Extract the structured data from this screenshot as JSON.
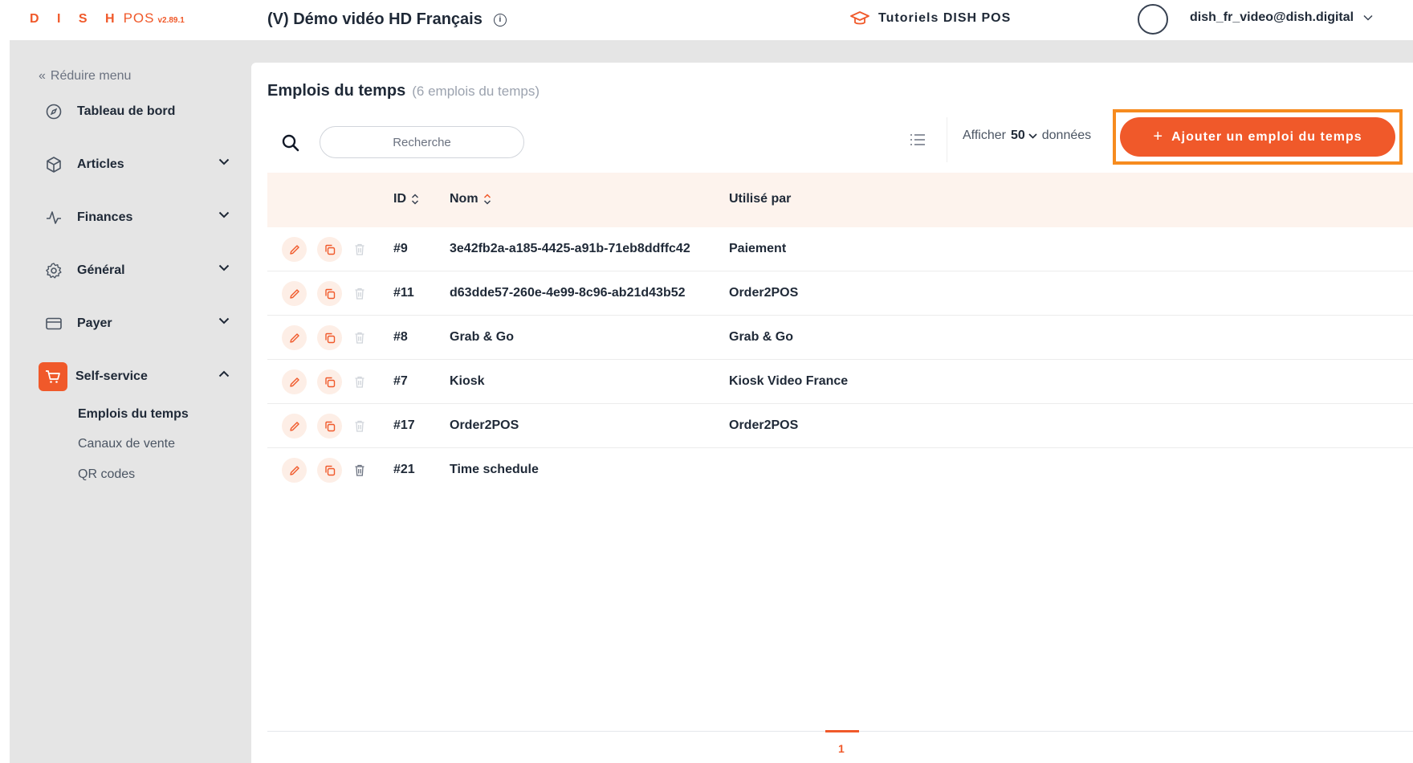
{
  "header": {
    "logo_brand": "D I S H",
    "logo_product": "POS",
    "logo_version": "v2.89.1",
    "venue": "(V) Démo vidéo HD Français",
    "tutorials": "Tutoriels DISH POS",
    "account": "dish_fr_video@dish.digital"
  },
  "sidebar": {
    "collapse": "Réduire menu",
    "items": [
      {
        "label": "Tableau de bord",
        "icon": "compass-icon"
      },
      {
        "label": "Articles",
        "icon": "box-icon"
      },
      {
        "label": "Finances",
        "icon": "pulse-icon"
      },
      {
        "label": "Général",
        "icon": "gear-icon"
      },
      {
        "label": "Payer",
        "icon": "card-icon"
      },
      {
        "label": "Self-service",
        "icon": "cart-icon"
      }
    ],
    "sub_items": [
      "Emplois du temps",
      "Canaux de vente",
      "QR codes"
    ]
  },
  "main": {
    "title": "Emplois du temps",
    "count": "(6 emplois du temps)",
    "search_placeholder": "Recherche",
    "show_label": "Afficher",
    "page_size": "50",
    "show_suffix": "données",
    "add_button": "Ajouter un emploi du temps",
    "columns": {
      "id": "ID",
      "name": "Nom",
      "used_by": "Utilisé par"
    },
    "rows": [
      {
        "id": "#9",
        "name": "3e42fb2a-a185-4425-a91b-71eb8ddffc42",
        "used_by": "Paiement"
      },
      {
        "id": "#11",
        "name": "d63dde57-260e-4e99-8c96-ab21d43b52",
        "used_by": "Order2POS"
      },
      {
        "id": "#8",
        "name": "Grab & Go",
        "used_by": "Grab & Go"
      },
      {
        "id": "#7",
        "name": "Kiosk",
        "used_by": "Kiosk Video France"
      },
      {
        "id": "#17",
        "name": "Order2POS",
        "used_by": "Order2POS"
      },
      {
        "id": "#21",
        "name": "Time schedule",
        "used_by": ""
      }
    ],
    "pagination": {
      "current": "1"
    }
  },
  "colors": {
    "accent": "#f0592a",
    "highlight": "#f68b1f",
    "header_row": "#fdf3ed",
    "frame": "#e5e5e5"
  }
}
